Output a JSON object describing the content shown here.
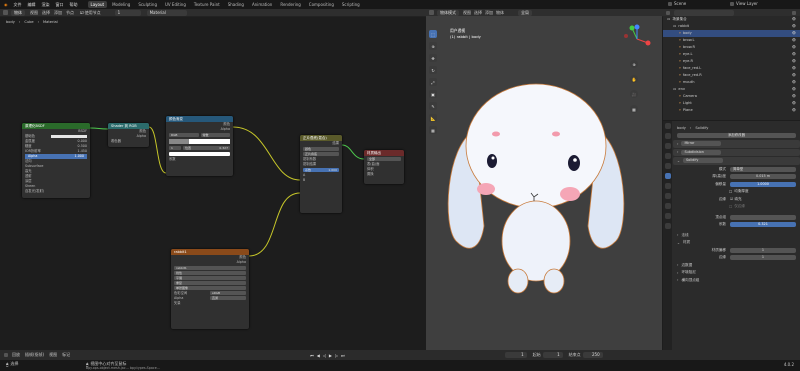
{
  "top_menu": [
    "文件",
    "编辑",
    "渲染",
    "窗口",
    "帮助"
  ],
  "workspace_tabs": [
    "Layout",
    "Modeling",
    "Sculpting",
    "UV Editing",
    "Texture Paint",
    "Shading",
    "Animation",
    "Rendering",
    "Compositing",
    "Scripting"
  ],
  "active_tab": "Layout",
  "scene_name": "Scene",
  "view_layer": "View Layer",
  "node_editor": {
    "header": {
      "mode": "物体",
      "view": "视图",
      "select": "选择",
      "add": "添加",
      "node": "节点",
      "use_nodes": "使用节点",
      "slot": "1",
      "material": "Material"
    },
    "breadcrumb": [
      "body",
      "Cube",
      "Material"
    ],
    "nodes": {
      "bsdf": {
        "title": "原理化BSDF",
        "out": "BSDF",
        "rows": [
          "基础色",
          "金属度",
          "糙度",
          "IOR折射率",
          "Alpha",
          "法向",
          "Subsurface",
          "高光",
          "透射",
          "涂层",
          "Sheen",
          "自发光(发射)"
        ],
        "values": [
          "",
          "0.000",
          "0.500",
          "1.450",
          "1.000"
        ]
      },
      "to_rgb": {
        "title": "Shader 到 RGB",
        "out1": "颜色",
        "out2": "Alpha",
        "in": "着色器"
      },
      "ramp": {
        "title": "颜色渐变",
        "out1": "颜色",
        "out2": "Alpha",
        "mode1": "RGB",
        "mode2": "常数",
        "pos_label": "位置",
        "pos_value": "0.327",
        "idx": "1",
        "in": "系数"
      },
      "mix": {
        "title": "正片叠底(混合)",
        "out": "结果",
        "type": "颜色",
        "blend": "正片叠底",
        "clamp_f": "钳制系数",
        "clamp_r": "钳制结果",
        "factor_label": "系数",
        "factor_value": "1.000",
        "a": "A",
        "b": "B"
      },
      "output": {
        "title": "材质输出",
        "target": "全部",
        "surface": "表(曲)面",
        "volume": "体积",
        "disp": "置换"
      },
      "image": {
        "title": "rabbit1",
        "out1": "颜色",
        "out2": "Alpha",
        "file": "rabbit1",
        "linear": "线性",
        "flat": "平展",
        "repeat": "重复",
        "single": "单张图像",
        "colorspace_label": "色彩空间",
        "colorspace": "sRGB",
        "alpha_label": "Alpha",
        "alpha": "直通",
        "vector": "矢量"
      }
    }
  },
  "viewport": {
    "header": {
      "mode": "物体模式",
      "view": "视图",
      "select": "选择",
      "add": "添加",
      "object": "物体",
      "orientation": "全局"
    },
    "view_name": "用户透视",
    "object_info": "(1) rabbit | body"
  },
  "outliner": {
    "rows": [
      {
        "name": "场景集合",
        "indent": 0
      },
      {
        "name": "rabbit",
        "indent": 1
      },
      {
        "name": "body",
        "indent": 2,
        "selected": true
      },
      {
        "name": "brow.L",
        "indent": 2
      },
      {
        "name": "brow.R",
        "indent": 2
      },
      {
        "name": "eye.L",
        "indent": 2
      },
      {
        "name": "eye.R",
        "indent": 2
      },
      {
        "name": "face_red.L",
        "indent": 2
      },
      {
        "name": "face_red.R",
        "indent": 2
      },
      {
        "name": "mouth",
        "indent": 2
      },
      {
        "name": "env",
        "indent": 1
      },
      {
        "name": "Camera",
        "indent": 2
      },
      {
        "name": "Light",
        "indent": 2
      },
      {
        "name": "Plane",
        "indent": 2
      }
    ]
  },
  "properties": {
    "object": "body",
    "modifier_tab": "Solidify",
    "add_modifier": "添加修改器",
    "modifiers": [
      "Mirror",
      "Subdivision",
      "Solidify"
    ],
    "mode_label": "模式",
    "mode_value": "简单型",
    "thickness_label": "厚(高)度",
    "thickness_value": "0.015 m",
    "offset_label": "偏移量",
    "offset_value": "1.0000",
    "even_label": "均衡厚度",
    "rim_label": "边缘",
    "rim_fill": "填充",
    "rim_only": "仅边缘",
    "vgroup_label": "顶点组",
    "factor_label": "系数",
    "factor_value": "0.321",
    "sections": [
      "法线",
      "材质",
      "边数据",
      "环境阻尼",
      "横向顶点组"
    ],
    "material_offset_label": "材质偏移",
    "material_offset_value": "1",
    "rim_offset_label": "边缘",
    "rim_offset_value": "1"
  },
  "timeline": {
    "play": "回放",
    "keying": "插帧(抠帧)",
    "view": "视图",
    "marker": "标记",
    "current": "1",
    "start_label": "起始",
    "start": "1",
    "end_label": "结束点",
    "end": "250"
  },
  "status": {
    "select": "选择",
    "center": "视图中心对齐至鼠标",
    "tip": "bpy.ops.object.mesh.jac... bpy.types.Space...",
    "version": "4.0.2"
  }
}
